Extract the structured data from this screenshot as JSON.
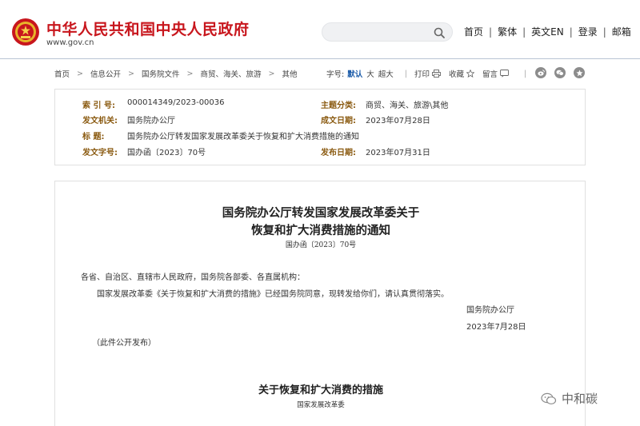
{
  "header": {
    "title": "中华人民共和国中央人民政府",
    "url": "www.gov.cn",
    "search": {
      "placeholder": "",
      "value": ""
    },
    "nav": [
      "首页",
      "繁体",
      "英文EN",
      "登录",
      "邮箱"
    ]
  },
  "breadcrumb": [
    "首页",
    "信息公开",
    "国务院文件",
    "商贸、海关、旅游",
    "其他"
  ],
  "tools": {
    "font_label": "字号:",
    "font_sizes": [
      "默认",
      "大",
      "超大"
    ],
    "print": "打印",
    "favorite": "收藏",
    "comment": "留言"
  },
  "share_icons": [
    "weibo-icon",
    "wechat-icon",
    "star-icon"
  ],
  "info": {
    "index_key": "索 引 号:",
    "index_val": "000014349/2023-00036",
    "category_key": "主题分类:",
    "category_val": "商贸、海关、旅游\\其他",
    "issuer_key": "发文机关:",
    "issuer_val": "国务院办公厅",
    "created_key": "成文日期:",
    "created_val": "2023年07月28日",
    "title_key": "标 题:",
    "title_val": "国务院办公厅转发国家发展改革委关于恢复和扩大消费措施的通知",
    "docno_key": "发文字号:",
    "docno_val": "国办函〔2023〕70号",
    "published_key": "发布日期:",
    "published_val": "2023年07月31日"
  },
  "document": {
    "title_line1": "国务院办公厅转发国家发展改革委关于",
    "title_line2": "恢复和扩大消费措施的通知",
    "doc_number": "国办函〔2023〕70号",
    "salutation": "各省、自治区、直辖市人民政府，国务院各部委、各直属机构：",
    "body": "国家发展改革委《关于恢复和扩大消费的措施》已经国务院同意，现转发给你们，请认真贯彻落实。",
    "signer": "国务院办公厅",
    "sign_date": "2023年7月28日",
    "note": "（此件公开发布）",
    "sub_title": "关于恢复和扩大消费的措施",
    "sub_issuer": "国家发展改革委"
  },
  "watermark": "中和碳",
  "colors": {
    "brand_red": "#c8161d",
    "label_brown": "#8a5a10",
    "active_blue": "#1a5aa8"
  }
}
